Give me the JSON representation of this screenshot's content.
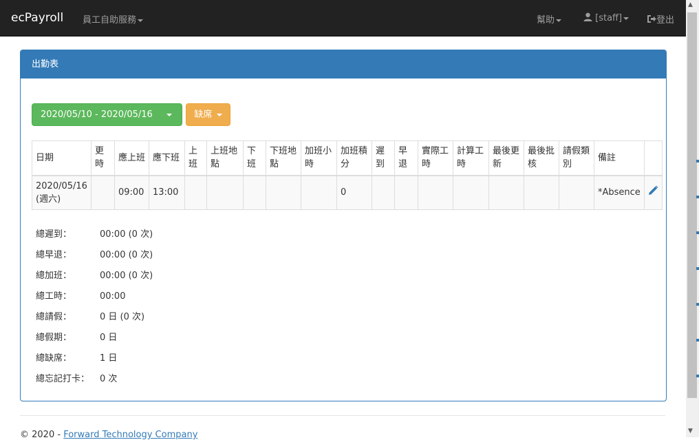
{
  "navbar": {
    "brand": "ecPayroll",
    "menu_selfservice": "員工自助服務",
    "menu_help": "幫助",
    "menu_user": "[staff]",
    "menu_logout": "登出"
  },
  "panel": {
    "title": "出勤表",
    "date_range": "2020/05/10 - 2020/05/16",
    "filter_label": "缺席"
  },
  "table": {
    "headers": [
      "日期",
      "更時",
      "應上班",
      "應下班",
      "上班",
      "上班地點",
      "下班",
      "下班地點",
      "加班小時",
      "加班積分",
      "遲到",
      "早退",
      "實際工時",
      "計算工時",
      "最後更新",
      "最後批核",
      "請假類別",
      "備註",
      ""
    ],
    "rows": [
      {
        "date": "2020/05/16",
        "weekday": "(週六)",
        "shift": "",
        "sched_in": "09:00",
        "sched_out": "13:00",
        "clock_in": "",
        "in_location": "",
        "clock_out": "",
        "out_location": "",
        "ot_hours": "",
        "ot_points": "0",
        "late": "",
        "early": "",
        "actual_hours": "",
        "calc_hours": "",
        "last_update": "",
        "last_approve": "",
        "leave_type": "",
        "remark": "*Absence"
      }
    ]
  },
  "summary": [
    {
      "label": "總遲到：",
      "value": "00:00 (0 次)"
    },
    {
      "label": "總早退：",
      "value": "00:00 (0 次)"
    },
    {
      "label": "總加班：",
      "value": "00:00 (0 次)"
    },
    {
      "label": "總工時：",
      "value": "00:00"
    },
    {
      "label": "總請假：",
      "value": "0 日 (0 次)"
    },
    {
      "label": "總假期：",
      "value": "0 日"
    },
    {
      "label": "總缺席：",
      "value": "1 日"
    },
    {
      "label": "總忘記打卡：",
      "value": "0 次"
    }
  ],
  "footer": {
    "copyright": "© 2020 -",
    "company": "Forward Technology Company"
  },
  "colors": {
    "primary": "#337ab7",
    "success": "#5cb85c",
    "warning": "#f0ad4e",
    "navbar": "#222222"
  }
}
